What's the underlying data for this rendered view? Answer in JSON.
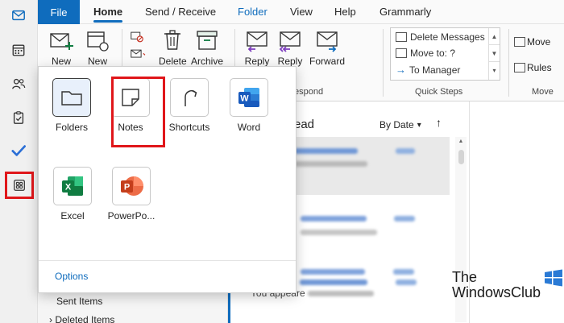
{
  "rail": {
    "items": [
      "mail-icon",
      "calendar-icon",
      "people-icon",
      "tasks-icon",
      "todo-icon",
      "more-apps-icon"
    ]
  },
  "tabs": {
    "file": "File",
    "home": "Home",
    "send_receive": "Send / Receive",
    "folder": "Folder",
    "view": "View",
    "help": "Help",
    "grammarly": "Grammarly"
  },
  "ribbon": {
    "new_email": "New",
    "new_items": "New",
    "delete": "Delete",
    "archive": "Archive",
    "reply": "Reply",
    "reply_all": "Reply",
    "forward": "Forward",
    "respond_group": "espond",
    "quick_steps": {
      "items": [
        "Delete Messages",
        "Move to: ?",
        "To Manager"
      ],
      "group_label": "Quick Steps"
    },
    "move": "Move",
    "rules": "Rules",
    "move_group": "Move"
  },
  "message_list": {
    "heading_fragment": "ead",
    "sort": "By Date",
    "preview_text": "You appeare"
  },
  "folders": {
    "sent": "Sent Items",
    "deleted": "Deleted Items"
  },
  "app_launcher": {
    "apps": [
      {
        "label": "Folders",
        "icon": "folder-icon"
      },
      {
        "label": "Notes",
        "icon": "note-icon"
      },
      {
        "label": "Shortcuts",
        "icon": "shortcut-arrow-icon"
      },
      {
        "label": "Word",
        "icon": "word-icon"
      },
      {
        "label": "Excel",
        "icon": "excel-icon"
      },
      {
        "label": "PowerPo...",
        "icon": "powerpoint-icon"
      }
    ],
    "options": "Options"
  },
  "watermark": {
    "line1": "The",
    "line2": "WindowsClub"
  },
  "colors": {
    "accent": "#0f6cbd",
    "highlight": "#e0161a",
    "word": "#185abd",
    "excel": "#107c41",
    "powerpoint": "#c43e1c"
  }
}
